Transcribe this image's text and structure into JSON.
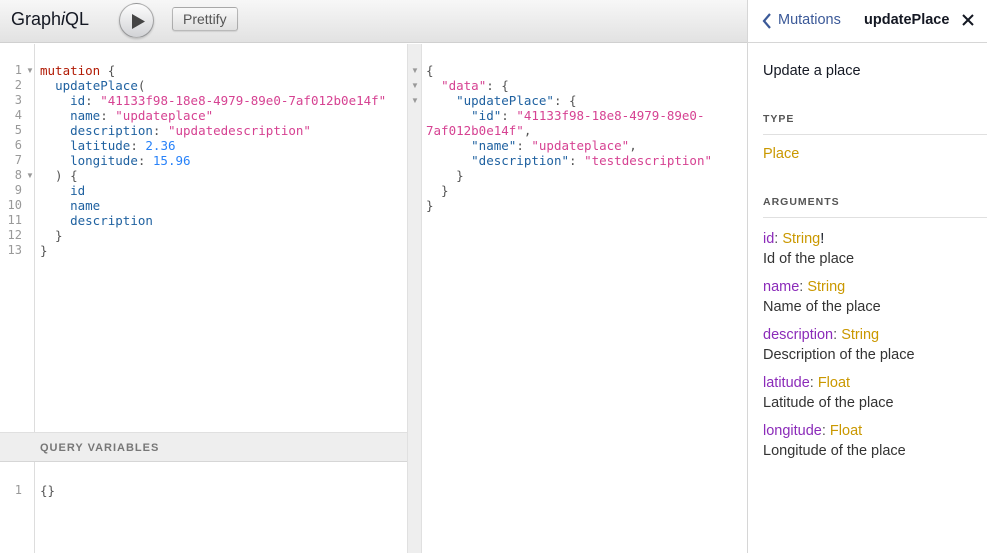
{
  "toolbar": {
    "logo_prefix": "Graph",
    "logo_italic": "i",
    "logo_suffix": "QL",
    "prettify_label": "Prettify"
  },
  "query": {
    "line_numbers": [
      "1",
      "2",
      "3",
      "4",
      "5",
      "6",
      "7",
      "8",
      "9",
      "10",
      "11",
      "12",
      "13"
    ],
    "lines": [
      [
        {
          "t": "mutation",
          "c": "kw"
        },
        {
          "t": " {",
          "c": "punct"
        }
      ],
      [
        {
          "t": "  ",
          "c": "plain"
        },
        {
          "t": "updatePlace",
          "c": "fn"
        },
        {
          "t": "(",
          "c": "punct"
        }
      ],
      [
        {
          "t": "    ",
          "c": "plain"
        },
        {
          "t": "id",
          "c": "attr"
        },
        {
          "t": ": ",
          "c": "punct"
        },
        {
          "t": "\"41133f98-18e8-4979-89e0-7af012b0e14f\"",
          "c": "str"
        }
      ],
      [
        {
          "t": "    ",
          "c": "plain"
        },
        {
          "t": "name",
          "c": "attr"
        },
        {
          "t": ": ",
          "c": "punct"
        },
        {
          "t": "\"updateplace\"",
          "c": "str"
        }
      ],
      [
        {
          "t": "    ",
          "c": "plain"
        },
        {
          "t": "description",
          "c": "attr"
        },
        {
          "t": ": ",
          "c": "punct"
        },
        {
          "t": "\"updatedescription\"",
          "c": "str"
        }
      ],
      [
        {
          "t": "    ",
          "c": "plain"
        },
        {
          "t": "latitude",
          "c": "attr"
        },
        {
          "t": ": ",
          "c": "punct"
        },
        {
          "t": "2.36",
          "c": "num"
        }
      ],
      [
        {
          "t": "    ",
          "c": "plain"
        },
        {
          "t": "longitude",
          "c": "attr"
        },
        {
          "t": ": ",
          "c": "punct"
        },
        {
          "t": "15.96",
          "c": "num"
        }
      ],
      [
        {
          "t": "  ) {",
          "c": "punct"
        }
      ],
      [
        {
          "t": "    ",
          "c": "plain"
        },
        {
          "t": "id",
          "c": "attr"
        }
      ],
      [
        {
          "t": "    ",
          "c": "plain"
        },
        {
          "t": "name",
          "c": "attr"
        }
      ],
      [
        {
          "t": "    ",
          "c": "plain"
        },
        {
          "t": "description",
          "c": "attr"
        }
      ],
      [
        {
          "t": "  }",
          "c": "punct"
        }
      ],
      [
        {
          "t": "}",
          "c": "punct"
        }
      ]
    ]
  },
  "variables": {
    "header": "QUERY VARIABLES",
    "line_number": "1",
    "content": "{}"
  },
  "result": {
    "lines": [
      [
        {
          "t": "{",
          "c": "punct"
        }
      ],
      [
        {
          "t": "  ",
          "c": "plain"
        },
        {
          "t": "\"data\"",
          "c": "str"
        },
        {
          "t": ": {",
          "c": "punct"
        }
      ],
      [
        {
          "t": "    ",
          "c": "plain"
        },
        {
          "t": "\"updatePlace\"",
          "c": "rkey"
        },
        {
          "t": ": {",
          "c": "punct"
        }
      ],
      [
        {
          "t": "      ",
          "c": "plain"
        },
        {
          "t": "\"id\"",
          "c": "rkey"
        },
        {
          "t": ": ",
          "c": "punct"
        },
        {
          "t": "\"41133f98-18e8-4979-89e0-",
          "c": "str"
        }
      ],
      [
        {
          "t": "7af012b0e14f\"",
          "c": "str"
        },
        {
          "t": ",",
          "c": "punct"
        }
      ],
      [
        {
          "t": "      ",
          "c": "plain"
        },
        {
          "t": "\"name\"",
          "c": "rkey"
        },
        {
          "t": ": ",
          "c": "punct"
        },
        {
          "t": "\"updateplace\"",
          "c": "str"
        },
        {
          "t": ",",
          "c": "punct"
        }
      ],
      [
        {
          "t": "      ",
          "c": "plain"
        },
        {
          "t": "\"description\"",
          "c": "rkey"
        },
        {
          "t": ": ",
          "c": "punct"
        },
        {
          "t": "\"testdescription\"",
          "c": "str"
        }
      ],
      [
        {
          "t": "    }",
          "c": "punct"
        }
      ],
      [
        {
          "t": "  }",
          "c": "punct"
        }
      ],
      [
        {
          "t": "}",
          "c": "punct"
        }
      ]
    ]
  },
  "docs": {
    "back_label": "Mutations",
    "title": "updatePlace",
    "description": "Update a place",
    "type_section": "TYPE",
    "return_type": "Place",
    "arguments_section": "ARGUMENTS",
    "arguments": [
      {
        "name": "id",
        "type": "String",
        "suffix": "!",
        "description": "Id of the place"
      },
      {
        "name": "name",
        "type": "String",
        "suffix": "",
        "description": "Name of the place"
      },
      {
        "name": "description",
        "type": "String",
        "suffix": "",
        "description": "Description of the place"
      },
      {
        "name": "latitude",
        "type": "Float",
        "suffix": "",
        "description": "Latitude of the place"
      },
      {
        "name": "longitude",
        "type": "Float",
        "suffix": "",
        "description": "Longitude of the place"
      }
    ]
  }
}
